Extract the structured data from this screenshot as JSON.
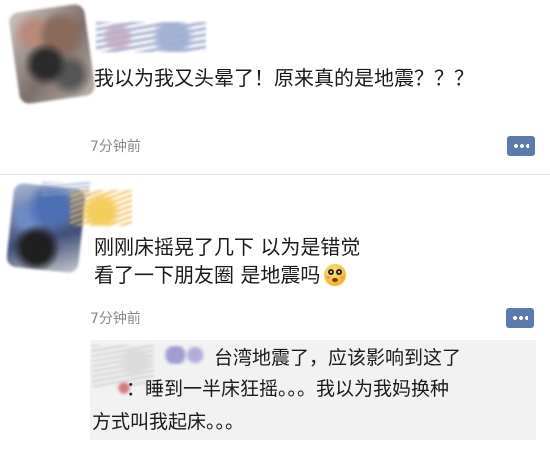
{
  "comments": [
    {
      "text": "我以为我又头晕了！原来真的是地震？？？",
      "time": "7分钟前"
    },
    {
      "line1": "刚刚床摇晃了几下 以为是错觉",
      "line2": "看了一下朋友圈 是地震吗",
      "time": "7分钟前",
      "reply": {
        "line1": "台湾地震了，应该影响到这了",
        "line2": "：睡到一半床狂摇。。。我以为我妈换种",
        "line3": "方式叫我起床。。。"
      }
    }
  ],
  "icons": {
    "comment_button": "comment-bubble-icon",
    "emoji": "flushed-face-icon"
  },
  "colors": {
    "accent": "#5b7ab0",
    "timestamp": "#8a8a8a",
    "reply_background": "#f2f2f2"
  }
}
